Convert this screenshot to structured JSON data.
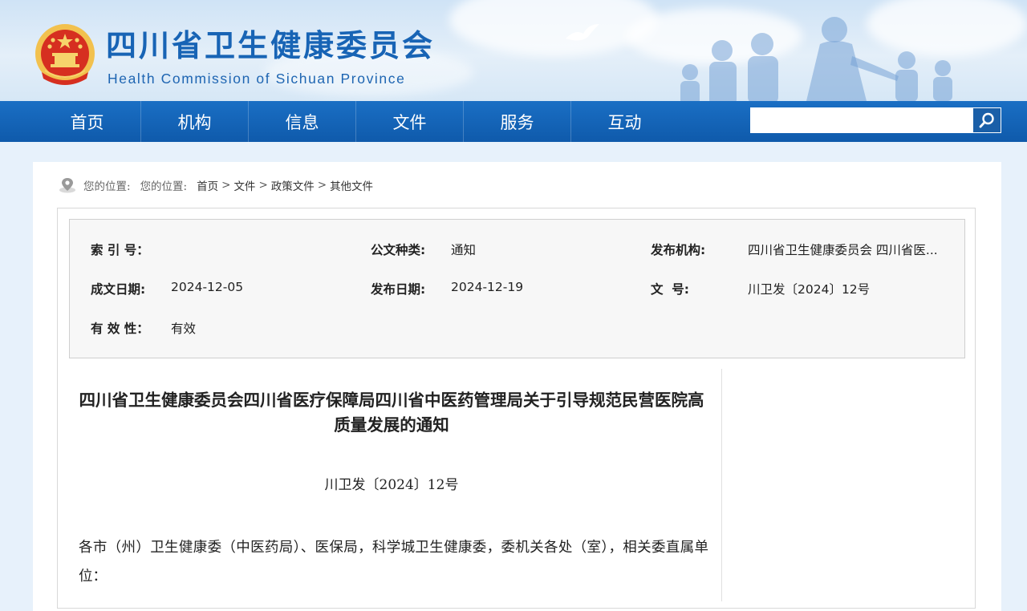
{
  "header": {
    "title": "四川省卫生健康委员会",
    "subtitle": "Health Commission of Sichuan Province"
  },
  "nav": {
    "items": [
      "首页",
      "机构",
      "信息",
      "文件",
      "服务",
      "互动"
    ],
    "search_value": "",
    "search_icon": "magnifier-icon"
  },
  "breadcrumb": {
    "location_label_1": "您的位置:",
    "location_label_2": "您的位置:",
    "items": [
      "首页",
      "文件",
      "政策文件",
      "其他文件"
    ],
    "separator": ">"
  },
  "meta": {
    "index_label": "索 引 号：",
    "index_value": "",
    "doc_type_label": "公文种类:",
    "doc_type_value": "通知",
    "publisher_label": "发布机构:",
    "publisher_value": "四川省卫生健康委员会 四川省医...",
    "written_date_label": "成文日期:",
    "written_date_value": "2024-12-05",
    "publish_date_label": "发布日期:",
    "publish_date_value": "2024-12-19",
    "doc_no_label": "文  号:",
    "doc_no_value": "川卫发〔2024〕12号",
    "validity_label": "有 效 性：",
    "validity_value": "有效"
  },
  "document": {
    "title": "四川省卫生健康委员会四川省医疗保障局四川省中医药管理局关于引导规范民营医院高质量发展的通知",
    "number": "川卫发〔2024〕12号",
    "body": "各市（州）卫生健康委（中医药局）、医保局，科学城卫生健康委，委机关各处（室），相关委直属单位："
  },
  "colors": {
    "brand_blue": "#1864b5",
    "nav_blue": "#1366b9",
    "emblem_red": "#d62f20",
    "emblem_gold": "#f2c14e"
  }
}
